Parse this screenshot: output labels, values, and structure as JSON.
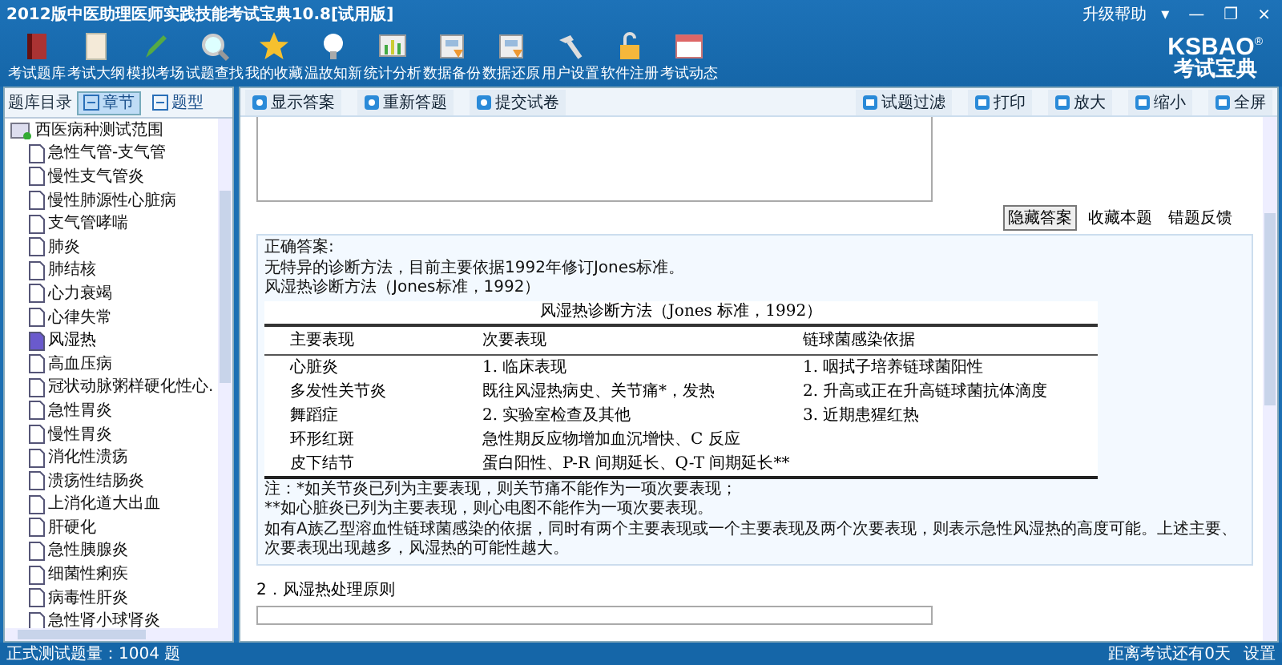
{
  "window": {
    "title": "2012版中医助理医师实践技能考试宝典10.8[试用版]",
    "help": "升级帮助",
    "controls": [
      "▾",
      "—",
      "❐",
      "×"
    ]
  },
  "logo": {
    "name": "KSBAO",
    "mark": "®",
    "subtitle": "考试宝典"
  },
  "toolbar": [
    {
      "label": "考试题库"
    },
    {
      "label": "考试大纲"
    },
    {
      "label": "模拟考场"
    },
    {
      "label": "试题查找"
    },
    {
      "label": "我的收藏"
    },
    {
      "label": "温故知新"
    },
    {
      "label": "统计分析"
    },
    {
      "label": "数据备份"
    },
    {
      "label": "数据还原"
    },
    {
      "label": "用户设置"
    },
    {
      "label": "软件注册"
    },
    {
      "label": "考试动态"
    }
  ],
  "sidebar": {
    "title": "题库目录",
    "tabs": [
      {
        "label": "章节",
        "selected": true
      },
      {
        "label": "题型",
        "selected": false
      }
    ],
    "tree": [
      {
        "label": "西医病种测试范围",
        "children": [
          {
            "label": "急性气管-支气管",
            "selected": false
          },
          {
            "label": "慢性支气管炎",
            "selected": false
          },
          {
            "label": "慢性肺源性心脏病",
            "selected": false
          },
          {
            "label": "支气管哮喘",
            "selected": false
          },
          {
            "label": "肺炎",
            "selected": false
          },
          {
            "label": "肺结核",
            "selected": false
          },
          {
            "label": "心力衰竭",
            "selected": false
          },
          {
            "label": "心律失常",
            "selected": false
          },
          {
            "label": "风湿热",
            "selected": true
          },
          {
            "label": "高血压病",
            "selected": false
          },
          {
            "label": "冠状动脉粥样硬化性心.",
            "selected": false
          },
          {
            "label": "急性胃炎",
            "selected": false
          },
          {
            "label": "慢性胃炎",
            "selected": false
          },
          {
            "label": "消化性溃疡",
            "selected": false
          },
          {
            "label": "溃疡性结肠炎",
            "selected": false
          },
          {
            "label": "上消化道大出血",
            "selected": false
          },
          {
            "label": "肝硬化",
            "selected": false
          },
          {
            "label": "急性胰腺炎",
            "selected": false
          },
          {
            "label": "细菌性痢疾",
            "selected": false
          },
          {
            "label": "病毒性肝炎",
            "selected": false
          },
          {
            "label": "急性肾小球肾炎",
            "selected": false
          }
        ]
      }
    ]
  },
  "content_toolbar": {
    "left": [
      "显示答案",
      "重新答题",
      "提交试卷"
    ],
    "right": [
      "试题过滤",
      "打印",
      "放大",
      "缩小",
      "全屏"
    ]
  },
  "answer_actions": [
    {
      "label": "隐藏答案",
      "selected": true
    },
    {
      "label": "收藏本题",
      "selected": false
    },
    {
      "label": "错题反馈",
      "selected": false
    }
  ],
  "answer": {
    "heading": "正确答案:",
    "lines": [
      "无特异的诊断方法，目前主要依据1992年修订Jones标准。",
      "风湿热诊断方法（Jones标准，1992）"
    ],
    "table": {
      "title": "风湿热诊断方法（Jones 标准，1992）",
      "columns": [
        "主要表现",
        "次要表现",
        "链球菌感染依据"
      ],
      "rows": [
        [
          "心脏炎",
          "1. 临床表现",
          "1. 咽拭子培养链球菌阳性"
        ],
        [
          "多发性关节炎",
          "既往风湿热病史、关节痛*，发热",
          "2. 升高或正在升高链球菌抗体滴度"
        ],
        [
          "舞蹈症",
          "2. 实验室检查及其他",
          "3. 近期患猩红热"
        ],
        [
          "环形红斑",
          "急性期反应物增加血沉增快、C 反应",
          ""
        ],
        [
          "皮下结节",
          "蛋白阳性、P-R 间期延长、Q-T 间期延长**",
          ""
        ]
      ]
    },
    "notes": [
      "注：*如关节炎已列为主要表现，则关节痛不能作为一项次要表现；",
      "**如心脏炎已列为主要表现，则心电图不能作为一项次要表现。",
      "如有A族乙型溶血性链球菌感染的依据，同时有两个主要表现或一个主要表现及两个次要表现，则表示急性风湿热的高度可能。上述主要、次要表现出现越多，风湿热的可能性越大。"
    ]
  },
  "next_question": "2．风湿热处理原则",
  "status_bar": {
    "left": "正式测试题量：1004 题",
    "countdown": "距离考试还有0天",
    "settings": "设置"
  }
}
